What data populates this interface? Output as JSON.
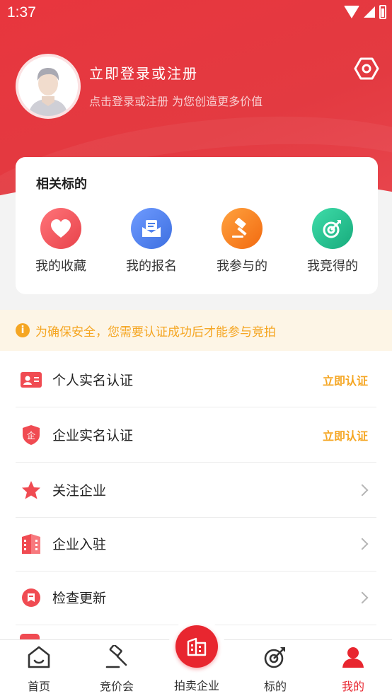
{
  "status_bar": {
    "time": "1:37"
  },
  "profile": {
    "title": "立即登录或注册",
    "subtitle": "点击登录或注册 为您创造更多价值"
  },
  "related": {
    "title": "相关标的",
    "items": [
      {
        "label": "我的收藏",
        "icon": "heart-icon",
        "color": "#ef4f57"
      },
      {
        "label": "我的报名",
        "icon": "envelope-icon",
        "color": "#4a7fe8"
      },
      {
        "label": "我参与的",
        "icon": "gavel-icon",
        "color": "#f6831e"
      },
      {
        "label": "我竞得的",
        "icon": "target-icon",
        "color": "#24c08f"
      }
    ]
  },
  "notice": {
    "text": "为确保安全，您需要认证成功后才能参与竞拍"
  },
  "menu": {
    "items": [
      {
        "label": "个人实名认证",
        "action": "立即认证",
        "icon": "id-card-icon"
      },
      {
        "label": "企业实名认证",
        "action": "立即认证",
        "icon": "enterprise-shield-icon"
      },
      {
        "label": "关注企业",
        "icon": "star-icon"
      },
      {
        "label": "企业入驻",
        "icon": "building-icon"
      },
      {
        "label": "检查更新",
        "icon": "update-icon"
      }
    ]
  },
  "tabbar": {
    "items": [
      {
        "label": "首页",
        "icon": "home-icon"
      },
      {
        "label": "竞价会",
        "icon": "gavel-icon"
      },
      {
        "label": "拍卖企业",
        "icon": "building-icon"
      },
      {
        "label": "标的",
        "icon": "target-icon"
      },
      {
        "label": "我的",
        "icon": "user-icon"
      }
    ],
    "active": "我的",
    "accent": "#e8262f"
  },
  "colors": {
    "header": "#e8363e",
    "warning": "#f5a623"
  }
}
